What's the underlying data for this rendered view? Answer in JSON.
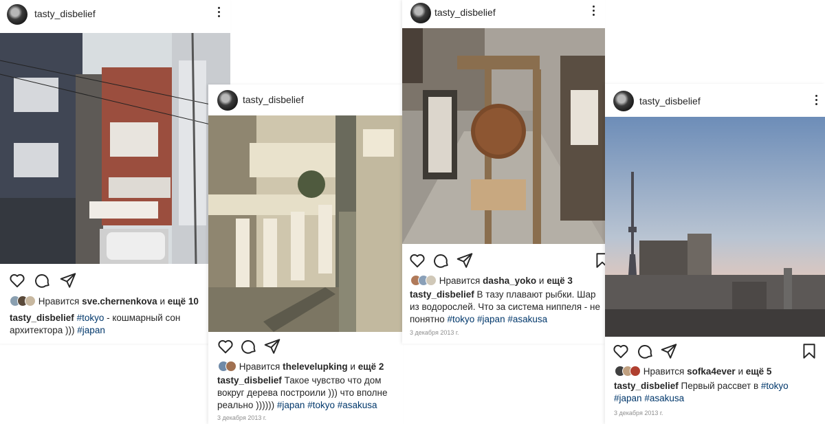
{
  "posts": [
    {
      "username": "tasty_disbelief",
      "likes_prefix": "Нравится",
      "liked_by": "sve.chernenkova",
      "likes_and": "и",
      "likes_more": "ещё 10",
      "caption_user": "tasty_disbelief",
      "caption_parts": [
        " ",
        "#tokyo",
        " - кошмарный сон архитектора ))) ",
        "#japan"
      ],
      "avatar_colors": [
        "#8a9fb0",
        "#5a4a3a",
        "#c8b8a0"
      ],
      "date": ""
    },
    {
      "username": "tasty_disbelief",
      "likes_prefix": "Нравится",
      "liked_by": "thelevelupking",
      "likes_and": "и",
      "likes_more": "ещё 2",
      "caption_user": "tasty_disbelief",
      "caption_parts": [
        " Такое чувство что дом вокруг дерева построили ))) что вполне реально )))))) ",
        "#japan",
        " ",
        "#tokyo",
        " ",
        "#asakusa"
      ],
      "avatar_colors": [
        "#6f8aa8",
        "#a07050"
      ],
      "date": "3 декабря 2013 г."
    },
    {
      "username": "tasty_disbelief",
      "likes_prefix": "Нравится",
      "liked_by": "dasha_yoko",
      "likes_and": "и",
      "likes_more": "ещё 3",
      "caption_user": "tasty_disbelief",
      "caption_parts": [
        " В тазу плавают рыбки. Шар из водорослей. Что за система ниппеля - не понятно ",
        "#tokyo",
        " ",
        "#japan",
        " ",
        "#asakusa"
      ],
      "avatar_colors": [
        "#b07a5a",
        "#8aa0b8",
        "#d0c8b8"
      ],
      "date": "3 декабря 2013 г."
    },
    {
      "username": "tasty_disbelief",
      "likes_prefix": "Нравится",
      "liked_by": "sofka4ever",
      "likes_and": "и",
      "likes_more": "ещё 5",
      "caption_user": "tasty_disbelief",
      "caption_parts": [
        " Первый рассвет в ",
        "#tokyo",
        " ",
        "#japan",
        " ",
        "#asakusa"
      ],
      "avatar_colors": [
        "#404040",
        "#c0a080",
        "#b04030"
      ],
      "date": "3 декабря 2013 г."
    }
  ],
  "icons": [
    "heart-icon",
    "comment-icon",
    "share-icon",
    "bookmark-icon",
    "more-options-icon"
  ],
  "colors": {
    "hashtag": "#00376b",
    "text": "#262626",
    "muted": "#8e8e8e"
  }
}
